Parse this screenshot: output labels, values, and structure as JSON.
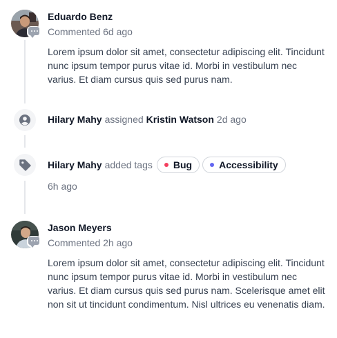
{
  "activity": [
    {
      "type": "comment",
      "author": "Eduardo Benz",
      "meta": "Commented 6d ago",
      "body": "Lorem ipsum dolor sit amet, consectetur adipiscing elit. Tincidunt nunc ipsum tempor purus vitae id. Morbi in vestibulum nec varius. Et diam cursus quis sed purus nam.",
      "avatar_icon": "avatar-photo",
      "badge_icon": "chat-bubble-icon"
    },
    {
      "type": "assignment",
      "actor": "Hilary Mahy",
      "verb": "assigned",
      "target": "Kristin Watson",
      "time": "2d ago",
      "icon": "user-circle-icon"
    },
    {
      "type": "tags",
      "actor": "Hilary Mahy",
      "verb": "added tags",
      "time": "6h ago",
      "icon": "tag-icon",
      "tags": [
        {
          "label": "Bug",
          "color": "#f43f5e"
        },
        {
          "label": "Accessibility",
          "color": "#6366f1"
        }
      ]
    },
    {
      "type": "comment",
      "author": "Jason Meyers",
      "meta": "Commented 2h ago",
      "body": "Lorem ipsum dolor sit amet, consectetur adipiscing elit. Tincidunt nunc ipsum tempor purus vitae id. Morbi in vestibulum nec varius. Et diam cursus quis sed purus nam. Scelerisque amet elit non sit ut tincidunt condimentum. Nisl ultrices eu venenatis diam.",
      "avatar_icon": "avatar-photo",
      "badge_icon": "chat-bubble-icon"
    }
  ]
}
